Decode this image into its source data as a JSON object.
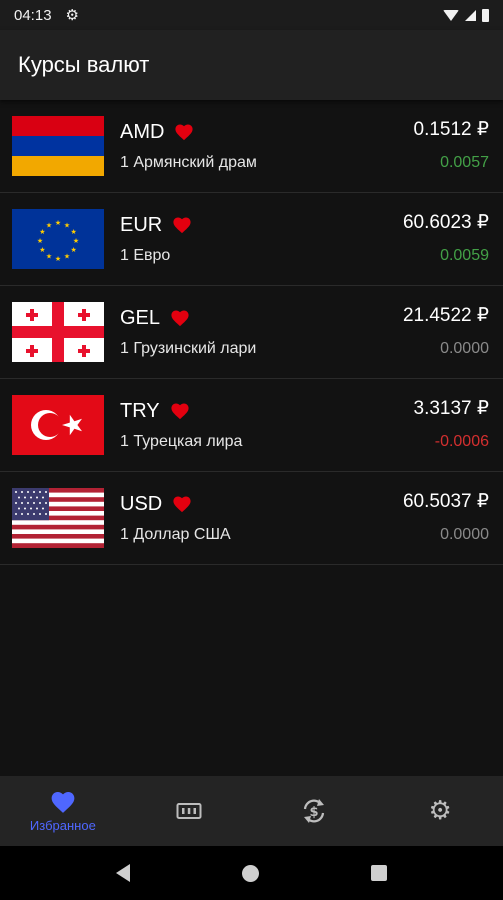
{
  "status_bar": {
    "time": "04:13"
  },
  "app_bar": {
    "title": "Курсы валют"
  },
  "currencies": [
    {
      "code": "AMD",
      "name": "1 Армянский драм",
      "rate": "0.1512 ₽",
      "change": "0.0057",
      "trend": "up",
      "flag": "armenia-flag"
    },
    {
      "code": "EUR",
      "name": "1 Евро",
      "rate": "60.6023 ₽",
      "change": "0.0059",
      "trend": "up",
      "flag": "eu-flag"
    },
    {
      "code": "GEL",
      "name": "1 Грузинский лари",
      "rate": "21.4522 ₽",
      "change": "0.0000",
      "trend": "zero",
      "flag": "georgia-flag"
    },
    {
      "code": "TRY",
      "name": "1 Турецкая лира",
      "rate": "3.3137 ₽",
      "change": "-0.0006",
      "trend": "down",
      "flag": "turkey-flag"
    },
    {
      "code": "USD",
      "name": "1 Доллар США",
      "rate": "60.5037 ₽",
      "change": "0.0000",
      "trend": "zero",
      "flag": "usa-flag"
    }
  ],
  "bottom_nav": {
    "items": [
      {
        "label": "Избранное",
        "icon": "heart-icon",
        "active": true
      },
      {
        "label": "",
        "icon": "currency-list-icon",
        "active": false
      },
      {
        "label": "",
        "icon": "converter-icon",
        "active": false
      },
      {
        "label": "",
        "icon": "settings-icon",
        "active": false
      }
    ]
  },
  "colors": {
    "background": "#121212",
    "app_bar": "#212121",
    "accent": "#4f67ff",
    "heart": "#e3000f",
    "up": "#43a047",
    "down": "#d32f2f",
    "zero": "#8a8a8a"
  }
}
